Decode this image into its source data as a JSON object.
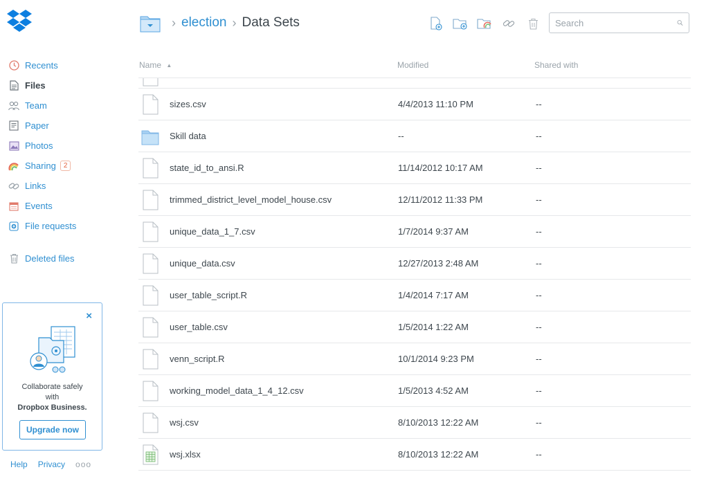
{
  "colors": {
    "accent": "#2f8fd1",
    "text": "#3d464d",
    "muted": "#9aa3aa",
    "border": "#e6e8ea",
    "badge": "#e3623e"
  },
  "sidebar": {
    "items": [
      {
        "label": "Recents",
        "icon": "clock-icon"
      },
      {
        "label": "Files",
        "icon": "file-icon",
        "active": true
      },
      {
        "label": "Team",
        "icon": "team-icon"
      },
      {
        "label": "Paper",
        "icon": "paper-icon"
      },
      {
        "label": "Photos",
        "icon": "photo-icon"
      },
      {
        "label": "Sharing",
        "icon": "rainbow-icon",
        "badge": "2"
      },
      {
        "label": "Links",
        "icon": "link-icon"
      },
      {
        "label": "Events",
        "icon": "calendar-icon"
      },
      {
        "label": "File requests",
        "icon": "file-request-icon"
      }
    ],
    "deleted_files": "Deleted files",
    "promo": {
      "line1": "Collaborate safely",
      "line2": "with",
      "line3": "Dropbox Business.",
      "button": "Upgrade now",
      "close": "×"
    },
    "footer": {
      "help": "Help",
      "privacy": "Privacy",
      "more": "ooo"
    }
  },
  "header": {
    "breadcrumb_parent": "election",
    "breadcrumb_current": "Data Sets",
    "separator": "›"
  },
  "toolbar": {
    "tools": [
      "new-file-icon",
      "new-folder-icon",
      "shared-folder-icon",
      "link-icon",
      "trash-icon"
    ]
  },
  "search": {
    "placeholder": "Search",
    "value": ""
  },
  "table": {
    "headers": {
      "name": "Name",
      "modified": "Modified",
      "shared": "Shared with",
      "sort_arrow": "▲"
    },
    "rows": [
      {
        "type": "file",
        "name": "sizes.csv",
        "modified": "4/4/2013 11:10 PM",
        "shared": "--"
      },
      {
        "type": "folder",
        "name": "Skill data",
        "modified": "--",
        "shared": "--"
      },
      {
        "type": "file",
        "name": "state_id_to_ansi.R",
        "modified": "11/14/2012 10:17 AM",
        "shared": "--"
      },
      {
        "type": "file",
        "name": "trimmed_district_level_model_house.csv",
        "modified": "12/11/2012 11:33 PM",
        "shared": "--"
      },
      {
        "type": "file",
        "name": "unique_data_1_7.csv",
        "modified": "1/7/2014 9:37 AM",
        "shared": "--"
      },
      {
        "type": "file",
        "name": "unique_data.csv",
        "modified": "12/27/2013 2:48 AM",
        "shared": "--"
      },
      {
        "type": "file",
        "name": "user_table_script.R",
        "modified": "1/4/2014 7:17 AM",
        "shared": "--"
      },
      {
        "type": "file",
        "name": "user_table.csv",
        "modified": "1/5/2014 1:22 AM",
        "shared": "--"
      },
      {
        "type": "file",
        "name": "venn_script.R",
        "modified": "10/1/2014 9:23 PM",
        "shared": "--"
      },
      {
        "type": "file",
        "name": "working_model_data_1_4_12.csv",
        "modified": "1/5/2013 4:52 AM",
        "shared": "--"
      },
      {
        "type": "file",
        "name": "wsj.csv",
        "modified": "8/10/2013 12:22 AM",
        "shared": "--"
      },
      {
        "type": "spreadsheet",
        "name": "wsj.xlsx",
        "modified": "8/10/2013 12:22 AM",
        "shared": "--"
      }
    ]
  }
}
